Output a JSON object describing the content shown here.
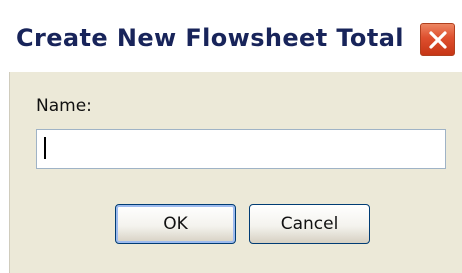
{
  "dialog": {
    "title": "Create New Flowsheet Total",
    "name_label": "Name:",
    "name_value": "",
    "ok_label": "OK",
    "cancel_label": "Cancel",
    "close_icon": "close-icon"
  },
  "colors": {
    "title_text": "#18245a",
    "body_background": "#ece9d8",
    "close_button": "#de4f2e",
    "button_border": "#003c74"
  }
}
